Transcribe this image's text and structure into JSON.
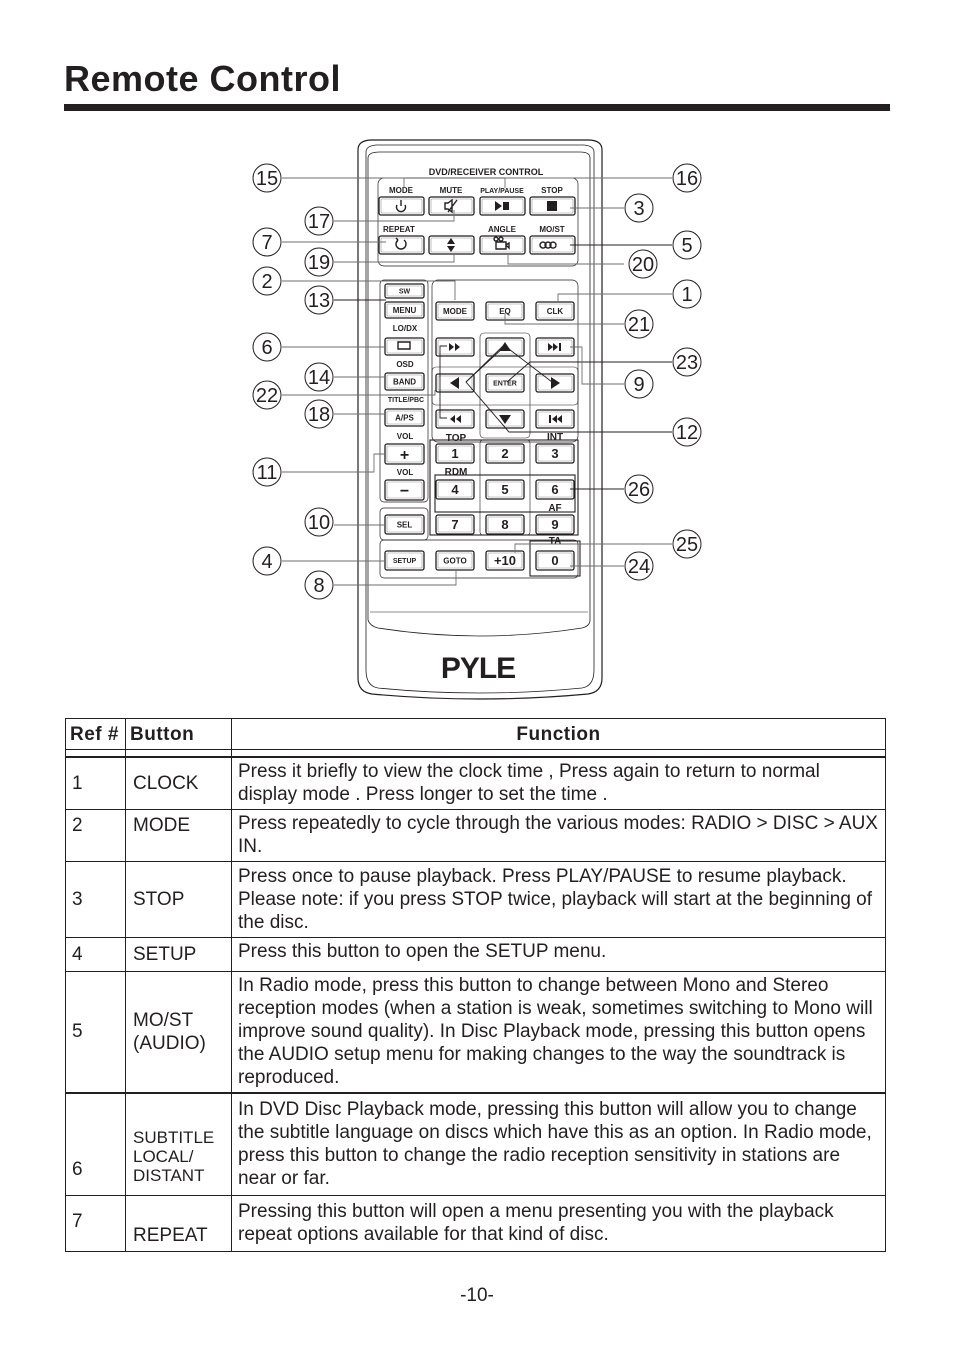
{
  "page": {
    "title": "Remote Control",
    "page_number": "-10-"
  },
  "remote": {
    "section_label": "DVD/RECEIVER CONTROL",
    "brand": "PYLE",
    "top_buttons": [
      {
        "label": "MODE",
        "icon": "power-icon"
      },
      {
        "label": "MUTE",
        "icon": "mute-icon"
      },
      {
        "label": "PLAY/PAUSE",
        "icon": "play-pause-icon"
      },
      {
        "label": "STOP",
        "icon": "stop-icon"
      },
      {
        "label": "REPEAT",
        "icon": "repeat-icon"
      },
      {
        "label": "",
        "icon": "up-down-icon"
      },
      {
        "label": "ANGLE",
        "icon": "camera-icon"
      },
      {
        "label": "MO/ST",
        "icon": "mono-stereo-icon"
      }
    ],
    "left_column": {
      "sw": "SW",
      "menu": "MENU",
      "lo_dx": "LO/DX",
      "subtitle_icon": "subtitle-icon",
      "osd": "OSD",
      "band": "BAND",
      "title_pbc": "TITLE/PBC",
      "aps": "A/PS",
      "vol_up_label": "VOL",
      "vol_up": "+",
      "vol_down_label": "VOL",
      "vol_down": "−",
      "sel": "SEL",
      "setup": "SETUP"
    },
    "center": {
      "mode": "MODE",
      "eq": "EQ",
      "clk": "CLK",
      "enter": "ENTER",
      "goto": "GOTO",
      "plus10": "+10"
    },
    "keypad": {
      "keys": [
        "1",
        "2",
        "3",
        "4",
        "5",
        "6",
        "7",
        "8",
        "9",
        "0"
      ],
      "top": "TOP",
      "int": "INT",
      "rdm": "RDM",
      "af": "AF",
      "ta": "TA"
    },
    "callouts_left": [
      "15",
      "17",
      "7",
      "19",
      "2",
      "13",
      "6",
      "14",
      "22",
      "18",
      "11",
      "10",
      "4",
      "8"
    ],
    "callouts_right": [
      "16",
      "3",
      "5",
      "20",
      "1",
      "21",
      "23",
      "9",
      "12",
      "26",
      "25",
      "24"
    ]
  },
  "table": {
    "headers": {
      "ref": "Ref #",
      "button": "Button",
      "function": "Function"
    },
    "rows": [
      {
        "ref": "1",
        "button": "CLOCK",
        "function": "Press it briefly to view the clock time , Press again to return to normal display mode . Press longer to set the time ."
      },
      {
        "ref": "2",
        "button": "MODE",
        "function": "Press repeatedly to cycle through the various modes: RADIO > DISC > AUX IN."
      },
      {
        "ref": "3",
        "button": "STOP",
        "function": "Press once to pause playback. Press PLAY/PAUSE to resume playback. Please note: if you press STOP twice, playback will start at the beginning of the disc."
      },
      {
        "ref": "4",
        "button": "SETUP",
        "function": "Press this button to open the SETUP menu."
      },
      {
        "ref": "5",
        "button": "MO/ST (AUDIO)",
        "function": "In Radio mode, press this button to change between Mono and Stereo reception modes (when a station is weak, sometimes switching to Mono will improve sound quality). In Disc Playback mode, pressing this button opens the AUDIO setup menu for making changes to the way the soundtrack is reproduced."
      },
      {
        "ref": "6",
        "button": "SUBTITLE LOCAL/ DISTANT",
        "function": "In DVD Disc Playback mode, pressing this button will allow you to change the subtitle language on discs which have this as an option. In Radio mode, press this button to change the radio reception sensitivity in stations are near or far."
      },
      {
        "ref": "7",
        "button": "REPEAT",
        "function": "Pressing this button will open a menu presenting you with the playback repeat options available for that kind of disc."
      }
    ]
  }
}
